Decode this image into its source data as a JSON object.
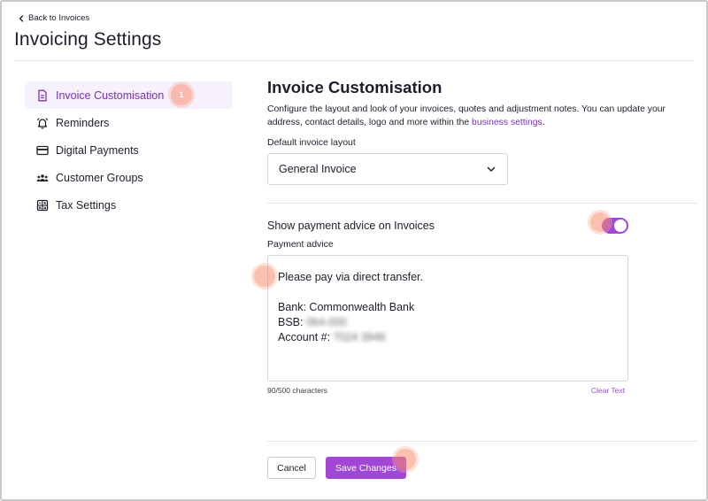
{
  "header": {
    "back_label": "Back to Invoices",
    "title": "Invoicing Settings"
  },
  "sidebar": {
    "items": [
      {
        "label": "Invoice Customisation",
        "icon": "document-icon",
        "active": true
      },
      {
        "label": "Reminders",
        "icon": "bell-icon",
        "active": false
      },
      {
        "label": "Digital Payments",
        "icon": "card-icon",
        "active": false
      },
      {
        "label": "Customer Groups",
        "icon": "group-icon",
        "active": false
      },
      {
        "label": "Tax Settings",
        "icon": "calculator-icon",
        "active": false
      }
    ]
  },
  "hotspots": {
    "first_number": "1"
  },
  "main": {
    "title": "Invoice Customisation",
    "description": "Configure the layout and look of your invoices, quotes and adjustment notes. You can update your address, contact details, logo and more within the ",
    "description_link": "business settings",
    "description_end": ".",
    "layout_label": "Default invoice layout",
    "layout_value": "General Invoice",
    "toggle_label": "Show payment advice on Invoices",
    "toggle_on": true,
    "advice_label": "Payment advice",
    "advice_line1": "Please pay via direct transfer.",
    "advice_line2": "Bank: Commonwealth Bank",
    "advice_bsb_label": "BSB: ",
    "advice_bsb_value": "064-000",
    "advice_account_label": "Account #: ",
    "advice_account_value": "7024 3946",
    "char_count": "90/500 characters",
    "clear_label": "Clear Text"
  },
  "footer": {
    "cancel_label": "Cancel",
    "save_label": "Save Changes"
  },
  "colors": {
    "accent": "#a047d6",
    "accent_text": "#7a2fb8",
    "active_bg": "#f6f1fc"
  }
}
